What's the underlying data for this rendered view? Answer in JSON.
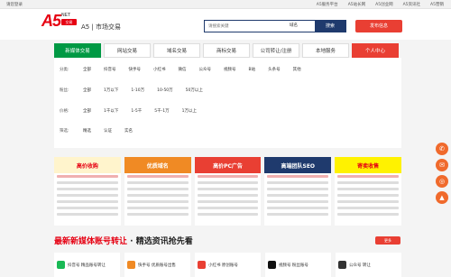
{
  "topbar": {
    "left": "请您登录",
    "links": [
      "A5服务平台",
      "A5站长网",
      "A5创业网",
      "A5资讯社",
      "A5营销"
    ]
  },
  "header": {
    "logo": "A5",
    "net": "NET",
    "badge": "交易",
    "slogan": "A5 | 市场交易",
    "search_placeholder": "请搜索关键",
    "search_select": "域名",
    "search_button": "搜索",
    "publish_button": "发布信息"
  },
  "nav": {
    "tabs": [
      "新媒体交易",
      "网站交易",
      "域名交易",
      "商标交易",
      "公司转让/注册",
      "本地服务",
      "个人中心"
    ]
  },
  "filters": {
    "rows": [
      {
        "label": "分类:",
        "opts": [
          "全部",
          "抖音号",
          "快手号",
          "小红书",
          "微信",
          "公众号",
          "视频号",
          "B站",
          "头条号",
          "其他"
        ]
      },
      {
        "label": "粉丝:",
        "opts": [
          "全部",
          "1万以下",
          "1-10万",
          "10-50万",
          "50万以上"
        ]
      },
      {
        "label": "价格:",
        "opts": [
          "全部",
          "1千以下",
          "1-5千",
          "5千-1万",
          "1万以上"
        ]
      },
      {
        "label": "筛选:",
        "opts": [
          "精选",
          "认证",
          "实名"
        ]
      }
    ]
  },
  "ads": [
    {
      "banner": "高价收购",
      "color": "#e60012",
      "bg": "#fff4cc"
    },
    {
      "banner": "优质域名",
      "color": "#fff",
      "bg": "#f08a24"
    },
    {
      "banner": "高价PC广告",
      "color": "#fff",
      "bg": "#e93f33"
    },
    {
      "banner": "高端团队SEO",
      "color": "#fff",
      "bg": "#1f3a6d"
    },
    {
      "banner": "寄卖收售",
      "color": "#e60012",
      "bg": "#fff200"
    }
  ],
  "hot": {
    "title": "最新新媒体账号转让",
    "sub": " · 精选资讯抢先看",
    "more": "更多"
  },
  "cards": [
    {
      "text": "抖音号 精品账号转让",
      "icon": "#19b955"
    },
    {
      "text": "快手号 优质账号出售",
      "icon": "#f08a24"
    },
    {
      "text": "小红书 原创账号",
      "icon": "#e93f33"
    },
    {
      "text": "视频号 粉丝账号",
      "icon": "#111"
    },
    {
      "text": "公众号 转让",
      "icon": "#333"
    }
  ]
}
